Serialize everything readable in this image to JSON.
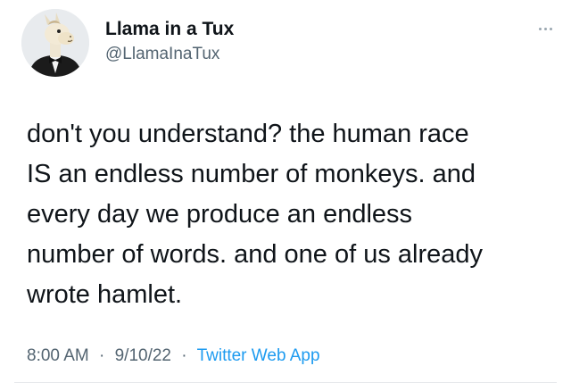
{
  "author": {
    "display_name": "Llama in a Tux",
    "handle": "@LlamaInaTux",
    "avatar_icon": "llama-in-tuxedo-avatar"
  },
  "more_icon": "ellipsis-icon",
  "tweet_lines": [
    "don't you understand? the human race",
    "IS an endless number of monkeys. and",
    "every day we produce an endless",
    "number of words. and one of us already",
    "wrote hamlet."
  ],
  "meta": {
    "time": "8:00 AM",
    "separator": "·",
    "date": "9/10/22",
    "source": "Twitter Web App"
  },
  "colors": {
    "text": "#0f1419",
    "secondary": "#536471",
    "link": "#1d9bf0"
  }
}
